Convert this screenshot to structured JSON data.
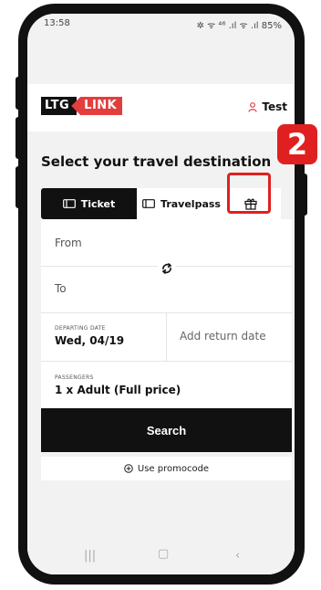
{
  "status_bar": {
    "time": "13:58",
    "icons": "✲ ᯤ ⁴⁶ .ıl ᯤ .ıl 85%",
    "battery_percent": "85%"
  },
  "header": {
    "logo_left": "LTG",
    "logo_right": "LINK",
    "user_name": "Test"
  },
  "main": {
    "title": "Select your travel destination",
    "tabs": [
      {
        "label": "Ticket",
        "active": true
      },
      {
        "label": "Travelpass",
        "active": false
      },
      {
        "label": "",
        "icon": "gift-icon"
      }
    ],
    "from_placeholder": "From",
    "to_placeholder": "To",
    "departing_label": "DEPARTING DATE",
    "departing_value": "Wed, 04/19",
    "return_placeholder": "Add return date",
    "passengers_label": "PASSENGERS",
    "passengers_value": "1 x Adult (Full price)",
    "search_label": "Search",
    "promo_label": "Use promocode"
  },
  "annotation": {
    "step_number": "2"
  },
  "colors": {
    "brand_red": "#e33d3d",
    "annotation_red": "#e02020",
    "dark": "#111111"
  }
}
